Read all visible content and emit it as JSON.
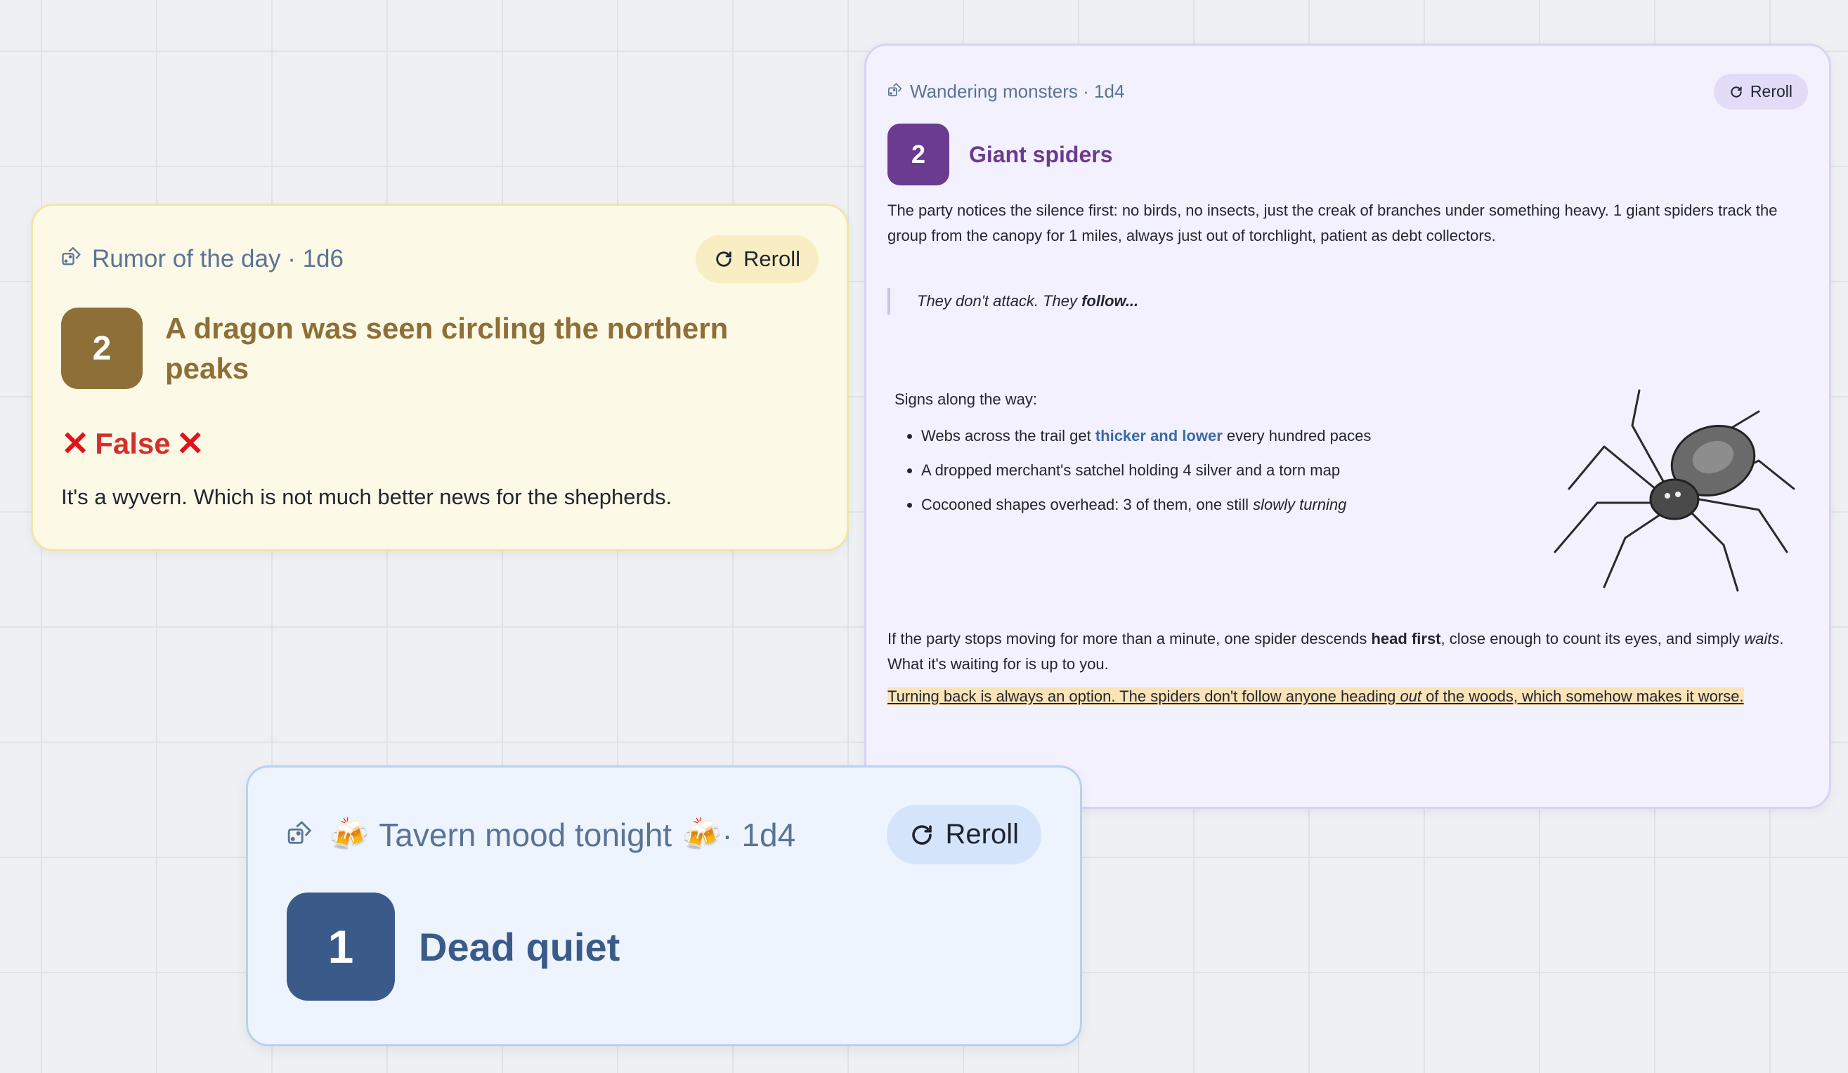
{
  "rumor": {
    "title": "Rumor of the day · 1d6",
    "reroll_label": "Reroll",
    "roll": "2",
    "result": "A dragon was seen circling the northern peaks",
    "verdict": "False",
    "verdict_icon": "cross-mark",
    "description": "It's a wyvern. Which is not much better news for the shepherds.",
    "colors": {
      "accent": "#8d6f37",
      "background": "#fdf9e7",
      "verdict": "#d32f2f"
    }
  },
  "monsters": {
    "title": "Wandering monsters · 1d4",
    "reroll_label": "Reroll",
    "roll": "2",
    "result": "Giant spiders",
    "paragraph1": "The party notices the silence first: no birds, no insects, just the creak of branches under something heavy. 1 giant spiders track the group from the canopy for 1 miles, always just out of torchlight, patient as debt collectors.",
    "quote_prefix": "They don't attack. They ",
    "quote_bold": "follow...",
    "signs_label": "Signs along the way:",
    "signs": {
      "item1_prefix": "Webs across the trail get ",
      "item1_link": "thicker and lower",
      "item1_suffix": " every hundred paces",
      "item2": "A dropped merchant's satchel holding 4 silver and a torn map",
      "item3_prefix": "Cocooned shapes overhead: 3 of them, one still ",
      "item3_em": "slowly turning"
    },
    "paragraph2_prefix": "If the party stops moving for more than a minute, one spider descends ",
    "paragraph2_bold": "head first",
    "paragraph2_mid": ", close enough to count its eyes, and simply ",
    "paragraph2_em": "waits",
    "paragraph2_suffix": ". What it's waiting for is up to you.",
    "highlight_prefix": "Turning back is always an option. The spiders don't follow anyone heading ",
    "highlight_em": "out",
    "highlight_suffix": " of the woods, which somehow makes it worse.",
    "image": "spider-sketch",
    "colors": {
      "accent": "#6a3b8f",
      "background": "#f3f1fd",
      "link": "#3b6aa8",
      "highlight": "#fbe3b8"
    }
  },
  "tavern": {
    "title": "Tavern mood tonight",
    "title_suffix": " · 1d4",
    "emoji": "🍻",
    "reroll_label": "Reroll",
    "roll": "1",
    "result": "Dead quiet",
    "colors": {
      "accent": "#3a5a8a",
      "background": "#edf4fd"
    }
  }
}
